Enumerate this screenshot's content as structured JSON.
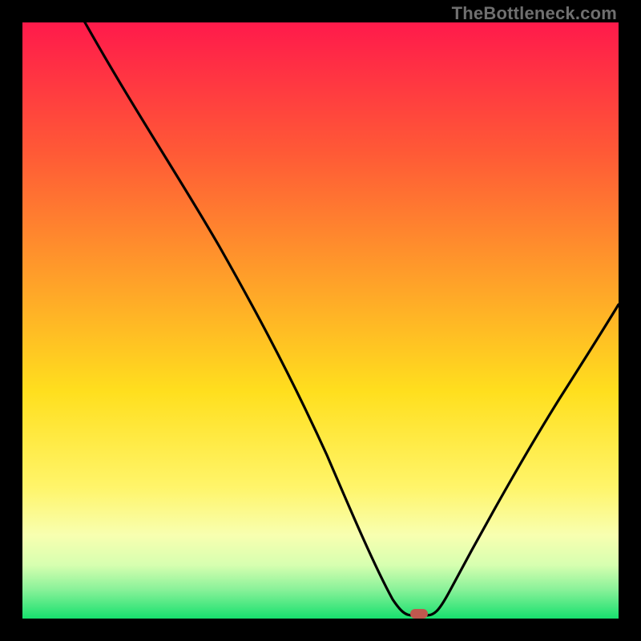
{
  "watermark": "TheBottleneck.com",
  "colors": {
    "top": "#ff1a4b",
    "upper": "#ff8a2a",
    "mid": "#ffdf1e",
    "lower": "#f8ff9a",
    "green_light": "#8cf29a",
    "green": "#17e06e",
    "curve": "#000000",
    "marker": "#c0584e",
    "frame": "#000000"
  },
  "chart_data": {
    "type": "line",
    "title": "",
    "xlabel": "",
    "ylabel": "",
    "xlim": [
      0,
      100
    ],
    "ylim": [
      0,
      100
    ],
    "x": [
      0,
      4,
      10,
      20,
      28,
      33,
      40,
      47,
      53,
      58,
      62,
      64,
      66,
      68,
      72,
      78,
      84,
      90,
      95,
      100
    ],
    "values": [
      130,
      100,
      88,
      72,
      60,
      49,
      36,
      23,
      11,
      3,
      0.5,
      0,
      0,
      0.5,
      5,
      17,
      30,
      42,
      51,
      59
    ],
    "minimum_x": 65,
    "minimum_y": 0,
    "series": [
      {
        "name": "bottleneck-curve",
        "x": [
          0,
          4,
          10,
          20,
          28,
          33,
          40,
          47,
          53,
          58,
          62,
          64,
          66,
          68,
          72,
          78,
          84,
          90,
          95,
          100
        ],
        "values": [
          130,
          100,
          88,
          72,
          60,
          49,
          36,
          23,
          11,
          3,
          0.5,
          0,
          0,
          0.5,
          5,
          17,
          30,
          42,
          51,
          59
        ]
      }
    ]
  }
}
